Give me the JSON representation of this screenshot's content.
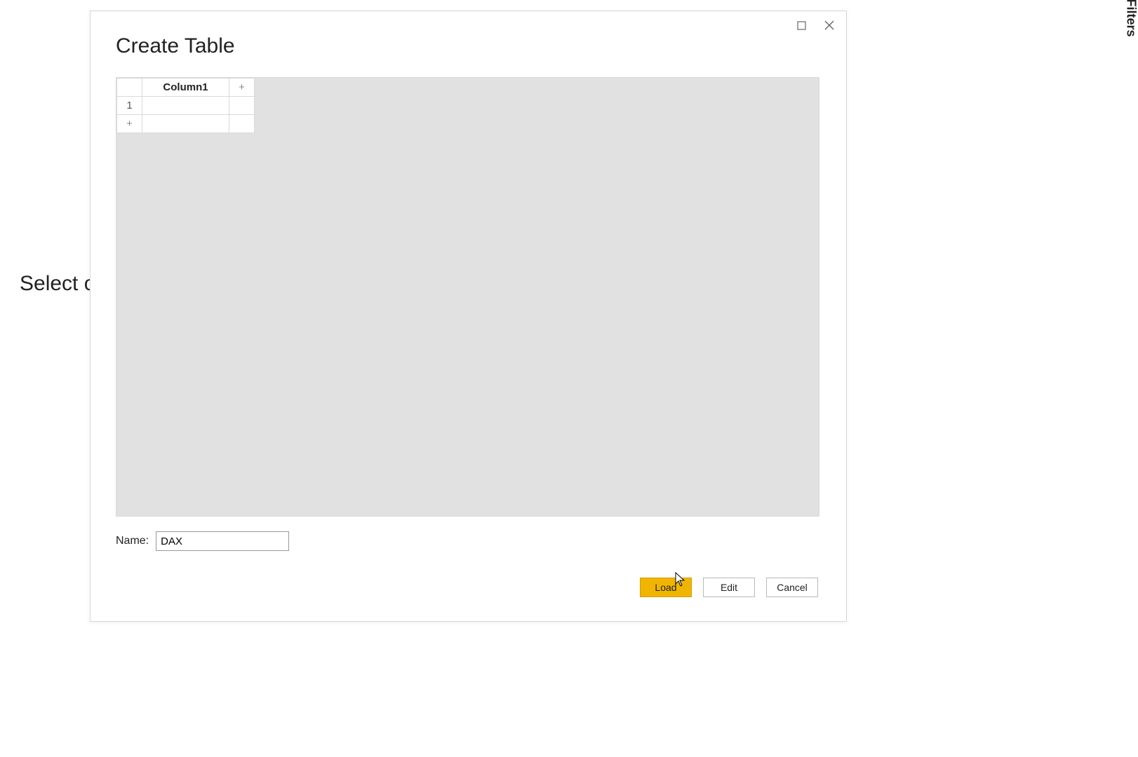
{
  "sidebar": {
    "filters_label": "Filters"
  },
  "background": {
    "partial_text": "Select o"
  },
  "dialog": {
    "title": "Create Table",
    "grid": {
      "column_header": "Column1",
      "row_number": "1",
      "add_column_label": "+",
      "add_row_label": "+"
    },
    "name_label": "Name:",
    "name_value": "DAX",
    "buttons": {
      "load": "Load",
      "edit": "Edit",
      "cancel": "Cancel"
    }
  }
}
